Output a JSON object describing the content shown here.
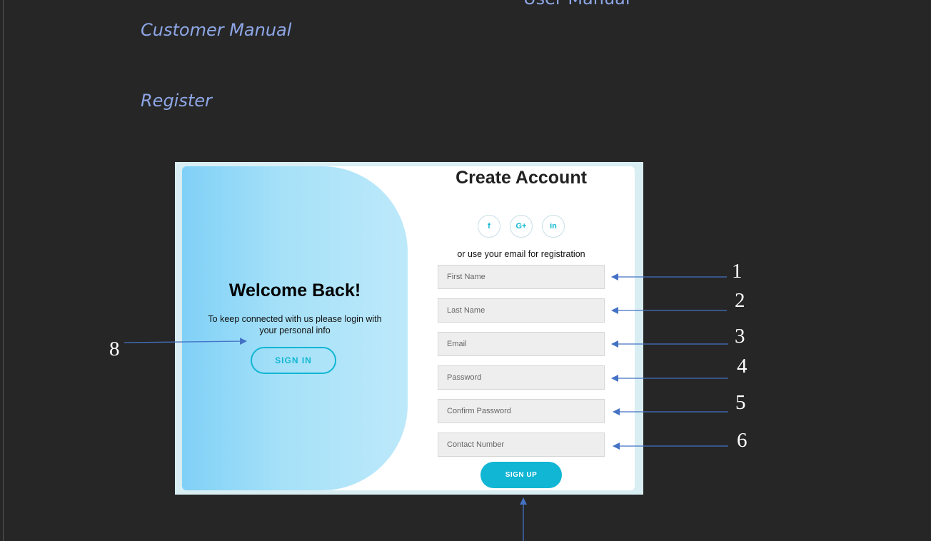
{
  "document": {
    "top_heading": "User Manual",
    "section": "Customer Manual",
    "subsection": "Register"
  },
  "screenshot": {
    "left_panel": {
      "title": "Welcome Back!",
      "text": "To keep connected with us please login with your personal info",
      "button": "SIGN IN"
    },
    "form": {
      "title": "Create Account",
      "social_icons": [
        {
          "name": "facebook-icon",
          "glyph": "f"
        },
        {
          "name": "google-plus-icon",
          "glyph": "G+"
        },
        {
          "name": "linkedin-icon",
          "glyph": "in"
        }
      ],
      "subtitle": "or use your email for registration",
      "fields": [
        {
          "placeholder": "First Name"
        },
        {
          "placeholder": "Last Name"
        },
        {
          "placeholder": "Email"
        },
        {
          "placeholder": "Password"
        },
        {
          "placeholder": "Confirm Password"
        },
        {
          "placeholder": "Contact Number"
        }
      ],
      "submit": "SIGN UP"
    },
    "accent_color": "#10b6d3"
  },
  "callouts": [
    "1",
    "2",
    "3",
    "4",
    "5",
    "6",
    "8"
  ],
  "arrow_color": "#4472c4"
}
